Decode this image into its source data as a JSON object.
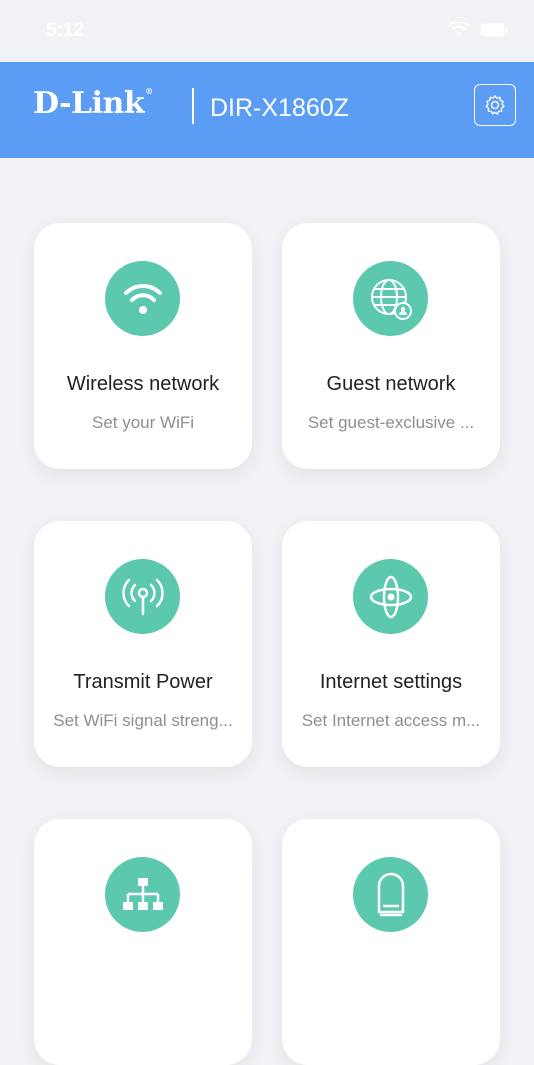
{
  "status_bar": {
    "time": "5:12"
  },
  "header": {
    "brand": "D-Link",
    "registered": "®",
    "model": "DIR-X1860Z"
  },
  "menu": [
    {
      "title": "Wireless network",
      "subtitle": "Set your WiFi",
      "icon": "wifi-icon"
    },
    {
      "title": "Guest network",
      "subtitle": "Set guest-exclusive ...",
      "icon": "globe-user-icon"
    },
    {
      "title": "Transmit Power",
      "subtitle": "Set WiFi signal streng...",
      "icon": "antenna-icon"
    },
    {
      "title": "Internet settings",
      "subtitle": "Set Internet access m...",
      "icon": "internet-orbit-icon"
    },
    {
      "title": "",
      "subtitle": "",
      "icon": "network-topology-icon"
    },
    {
      "title": "",
      "subtitle": "",
      "icon": "router-device-icon"
    }
  ],
  "colors": {
    "header": "#5b9cf5",
    "accent": "#5cc8ae",
    "background": "#f1f2f5"
  }
}
